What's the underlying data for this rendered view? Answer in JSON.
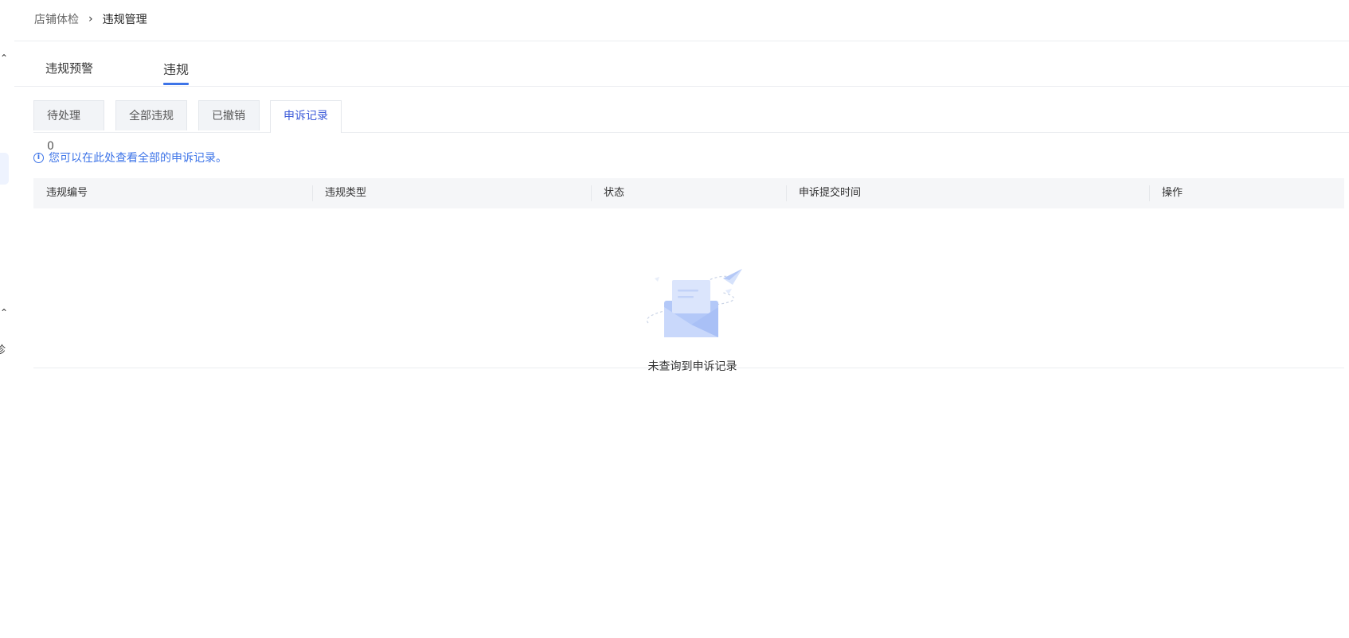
{
  "breadcrumb": {
    "parent": "店铺体检",
    "separator": "›",
    "current": "违规管理"
  },
  "left_edge": {
    "cut_char": "诊"
  },
  "main_tabs": [
    {
      "label": "违规预警"
    },
    {
      "label": "违规"
    }
  ],
  "sub_tabs": [
    {
      "label": "待处理 0"
    },
    {
      "label": "全部违规"
    },
    {
      "label": "已撤销"
    },
    {
      "label": "申诉记录"
    }
  ],
  "notice": {
    "icon": "info-icon",
    "text": "您可以在此处查看全部的申诉记录。"
  },
  "table": {
    "columns": [
      "违规编号",
      "违规类型",
      "状态",
      "申诉提交时间",
      "操作"
    ],
    "empty_text": "未查询到申诉记录"
  },
  "colors": {
    "accent": "#3d74e8",
    "active_subtab_text": "#3d5bd9",
    "header_bg": "#f5f6f8"
  }
}
